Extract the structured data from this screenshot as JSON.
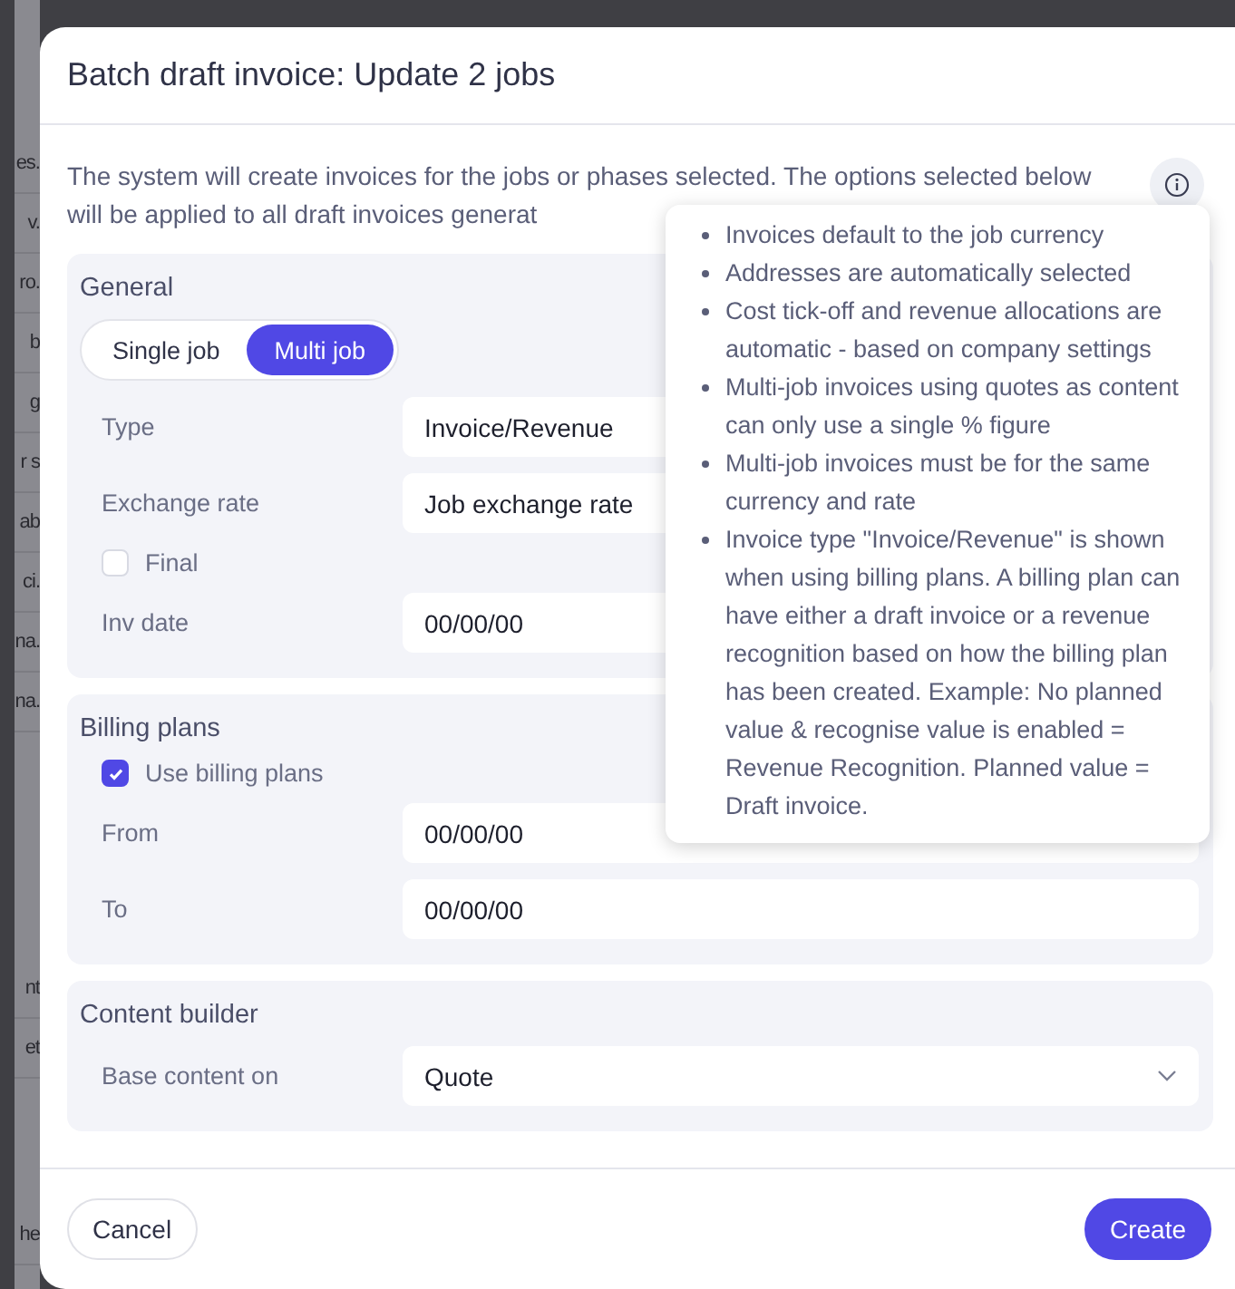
{
  "background_list": {
    "upper": [
      "es.",
      "v.",
      "ro.",
      "b",
      "g",
      "r s",
      "ab",
      "ci.",
      "na.",
      "na."
    ],
    "lower": [
      "nt",
      "et"
    ],
    "bottom": [
      "he"
    ]
  },
  "dialog": {
    "title": "Batch draft invoice: Update 2 jobs",
    "description": "The system will create invoices for the jobs or phases selected. The options selected below will be applied to all draft invoices generat",
    "info_tooltip": {
      "items": [
        "Invoices default to the job currency",
        "Addresses are automatically selected",
        "Cost tick-off and revenue allocations are automatic - based on company settings",
        "Multi-job invoices using quotes as content can only use a single % figure",
        "Multi-job invoices must be for the same currency and rate",
        "Invoice type \"Invoice/Revenue\" is shown when using billing plans. A billing plan can have either a draft invoice or a revenue recognition based on how the billing plan has been created. Example: No planned value & recognise value is enabled = Revenue Recognition. Planned value = Draft invoice."
      ]
    }
  },
  "sections": [
    {
      "title": "General",
      "mode_toggle": [
        {
          "label": "Single job",
          "selected": false
        },
        {
          "label": "Multi job",
          "selected": true
        }
      ],
      "fields": [
        {
          "kind": "input",
          "label": "Type",
          "value": "Invoice/Revenue"
        },
        {
          "kind": "input",
          "label": "Exchange rate",
          "value": "Job exchange rate"
        },
        {
          "kind": "checkbox",
          "label": "Final",
          "checked": false
        },
        {
          "kind": "input",
          "label": "Inv date",
          "value": "00/00/00"
        }
      ]
    },
    {
      "title": "Billing plans",
      "fields": [
        {
          "kind": "checkbox",
          "label": "Use billing plans",
          "checked": true
        },
        {
          "kind": "input",
          "label": "From",
          "value": "00/00/00"
        },
        {
          "kind": "input",
          "label": "To",
          "value": "00/00/00"
        }
      ]
    },
    {
      "title": "Content builder",
      "fields": [
        {
          "kind": "select",
          "label": "Base content on",
          "value": "Quote"
        }
      ]
    }
  ],
  "buttons": [
    {
      "label": "Cancel",
      "kind": "secondary"
    },
    {
      "label": "Create",
      "kind": "primary"
    }
  ]
}
